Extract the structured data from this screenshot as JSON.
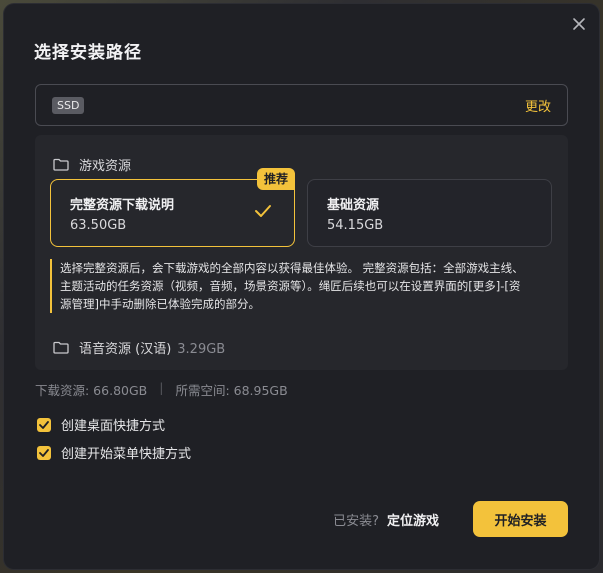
{
  "dialog": {
    "title": "选择安装路径",
    "close_icon": "close-icon"
  },
  "path": {
    "badge": "SSD",
    "change_label": "更改"
  },
  "game_resources": {
    "section_label": "游戏资源",
    "full": {
      "title": "完整资源下载说明",
      "size": "63.50GB",
      "recommend_badge": "推荐",
      "selected": true
    },
    "base": {
      "title": "基础资源",
      "size": "54.15GB",
      "selected": false
    },
    "description_line1": "选择完整资源后，会下载游戏的全部内容以获得最佳体验。 完整资源包括：全部游戏主线、",
    "description_line2": "主题活动的任务资源（视频，音频，场景资源等）。绳匠后续也可以在设置界面的[更多]-[资",
    "description_line3": "源管理]中手动删除已体验完成的部分。"
  },
  "voice_resources": {
    "label": "语音资源 (汉语)",
    "size": "3.29GB"
  },
  "summary": {
    "download": "下载资源: 66.80GB",
    "separator": "|",
    "required": "所需空间: 68.95GB"
  },
  "options": [
    {
      "label": "创建桌面快捷方式",
      "checked": true
    },
    {
      "label": "创建开始菜单快捷方式",
      "checked": true
    }
  ],
  "footer": {
    "installed_label": "已安装?",
    "locate_label": "定位游戏",
    "start_label": "开始安装"
  },
  "colors": {
    "accent": "#f3c23b",
    "dialog_bg": "#1f2025",
    "panel_bg": "#26272c"
  }
}
